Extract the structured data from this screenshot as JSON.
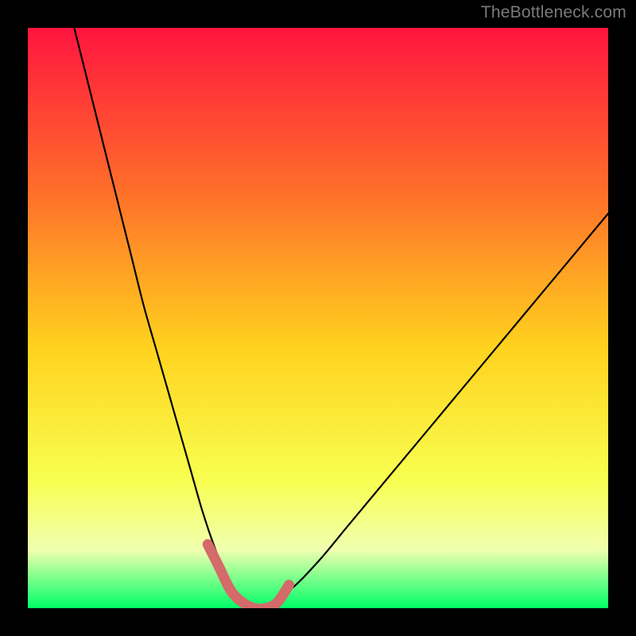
{
  "watermark": "TheBottleneck.com",
  "colors": {
    "background": "#000000",
    "gradient_top": "#ff153f",
    "gradient_upper_mid": "#ff6e2a",
    "gradient_mid": "#ffd21e",
    "gradient_lower_mid": "#f8ff50",
    "gradient_low": "#f0ffb0",
    "gradient_bottom": "#00ff66",
    "curve": "#000000",
    "highlight": "#d46a6a"
  },
  "chart_data": {
    "type": "line",
    "title": "",
    "xlabel": "",
    "ylabel": "",
    "xlim": [
      0,
      100
    ],
    "ylim": [
      0,
      100
    ],
    "series": [
      {
        "name": "bottleneck-curve",
        "x": [
          8,
          10,
          12,
          14,
          16,
          18,
          20,
          22,
          24,
          26,
          28,
          30,
          32,
          34,
          36,
          38,
          40,
          45,
          50,
          55,
          60,
          65,
          70,
          75,
          80,
          85,
          90,
          95,
          100
        ],
        "values": [
          100,
          92,
          84,
          76,
          68,
          60,
          52,
          45,
          38,
          31,
          24,
          17,
          11,
          6,
          2,
          0,
          0,
          3,
          8,
          14,
          20,
          26,
          32,
          38,
          44,
          50,
          56,
          62,
          68
        ]
      },
      {
        "name": "optimal-band",
        "x": [
          31,
          33,
          35,
          37,
          39,
          41,
          43,
          45
        ],
        "values": [
          11,
          7,
          3,
          1,
          0,
          0,
          1,
          4
        ]
      }
    ],
    "annotations": []
  }
}
